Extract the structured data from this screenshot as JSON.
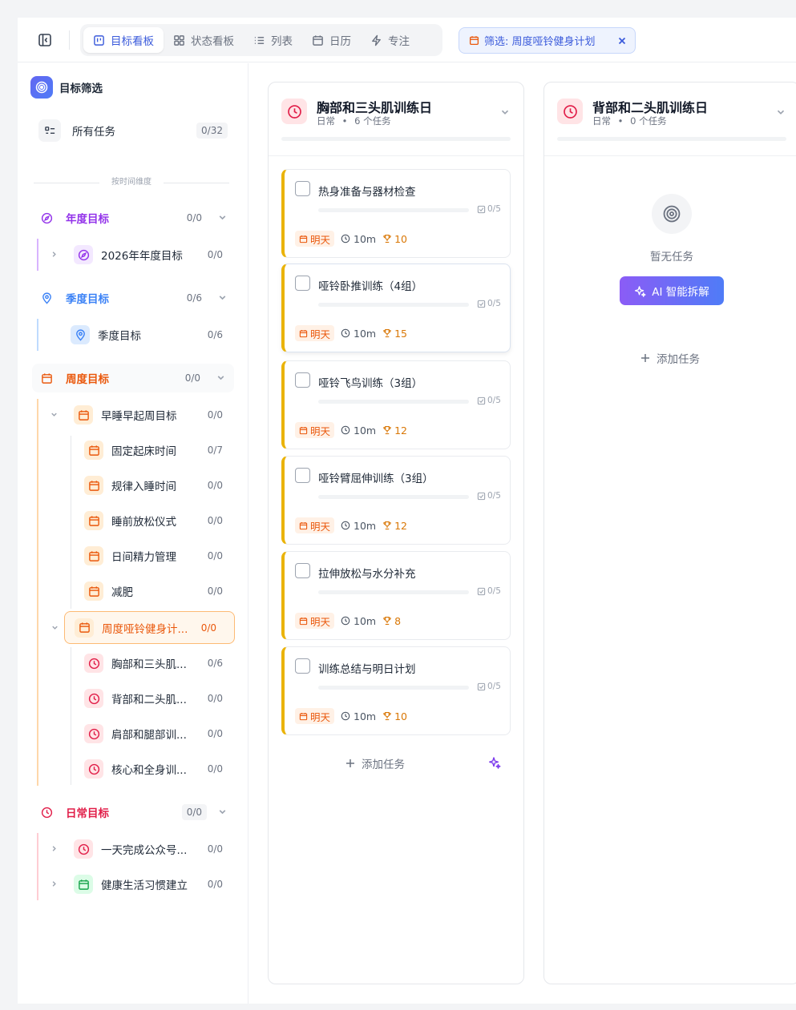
{
  "topbar": {
    "tabs": [
      {
        "label": "目标看板",
        "icon": "kanban-icon"
      },
      {
        "label": "状态看板",
        "icon": "grid-icon"
      },
      {
        "label": "列表",
        "icon": "list-icon"
      },
      {
        "label": "日历",
        "icon": "calendar-icon"
      },
      {
        "label": "专注",
        "icon": "lightning-icon"
      }
    ],
    "active_tab": "目标看板",
    "filter_label": "筛选: 周度哑铃健身计划"
  },
  "sidebar": {
    "title": "目标筛选",
    "all_tasks": {
      "label": "所有任务",
      "count": "0/32"
    },
    "dimension_label": "按时间维度",
    "annual": {
      "label": "年度目标",
      "count": "0/0",
      "children": [
        {
          "label": "2026年年度目标",
          "count": "0/0"
        }
      ]
    },
    "quarterly": {
      "label": "季度目标",
      "count": "0/6",
      "children": [
        {
          "label": "季度目标",
          "count": "0/6"
        }
      ]
    },
    "weekly": {
      "label": "周度目标",
      "count": "0/0",
      "sleep_goal": {
        "label": "早睡早起周目标",
        "count": "0/0"
      },
      "sleep_children": [
        {
          "label": "固定起床时间",
          "count": "0/7"
        },
        {
          "label": "规律入睡时间",
          "count": "0/0"
        },
        {
          "label": "睡前放松仪式",
          "count": "0/0"
        },
        {
          "label": "日间精力管理",
          "count": "0/0"
        },
        {
          "label": "减肥",
          "count": "0/0"
        }
      ],
      "fitness_goal": {
        "label": "周度哑铃健身计...",
        "count": "0/0"
      },
      "fitness_children": [
        {
          "label": "胸部和三头肌...",
          "count": "0/6"
        },
        {
          "label": "背部和二头肌...",
          "count": "0/0"
        },
        {
          "label": "肩部和腿部训...",
          "count": "0/0"
        },
        {
          "label": "核心和全身训...",
          "count": "0/0"
        }
      ]
    },
    "daily": {
      "label": "日常目标",
      "count": "0/0",
      "children": [
        {
          "label": "一天完成公众号...",
          "count": "0/0"
        },
        {
          "label": "健康生活习惯建立",
          "count": "0/0"
        }
      ]
    }
  },
  "columns": [
    {
      "title": "胸部和三头肌训练日",
      "type": "日常",
      "task_count": "6 个任务",
      "tasks": [
        {
          "title": "热身准备与器材检查",
          "subtasks": "0/5",
          "due": "明天",
          "duration": "10m",
          "points": "10"
        },
        {
          "title": "哑铃卧推训练（4组）",
          "subtasks": "0/5",
          "due": "明天",
          "duration": "10m",
          "points": "15"
        },
        {
          "title": "哑铃飞鸟训练（3组）",
          "subtasks": "0/5",
          "due": "明天",
          "duration": "10m",
          "points": "12"
        },
        {
          "title": "哑铃臂屈伸训练（3组）",
          "subtasks": "0/5",
          "due": "明天",
          "duration": "10m",
          "points": "12"
        },
        {
          "title": "拉伸放松与水分补充",
          "subtasks": "0/5",
          "due": "明天",
          "duration": "10m",
          "points": "8"
        },
        {
          "title": "训练总结与明日计划",
          "subtasks": "0/5",
          "due": "明天",
          "duration": "10m",
          "points": "10"
        }
      ],
      "add_label": "添加任务"
    },
    {
      "title": "背部和二头肌训练日",
      "type": "日常",
      "task_count": "0 个任务",
      "empty_text": "暂无任务",
      "ai_button": "AI 智能拆解",
      "add_label": "添加任务"
    }
  ],
  "colors": {
    "accent": "#3b5bdb",
    "annual": "#9333ea",
    "quarterly": "#3b82f6",
    "weekly": "#ea580c",
    "daily": "#e11d48",
    "task_border": "#eab308"
  }
}
